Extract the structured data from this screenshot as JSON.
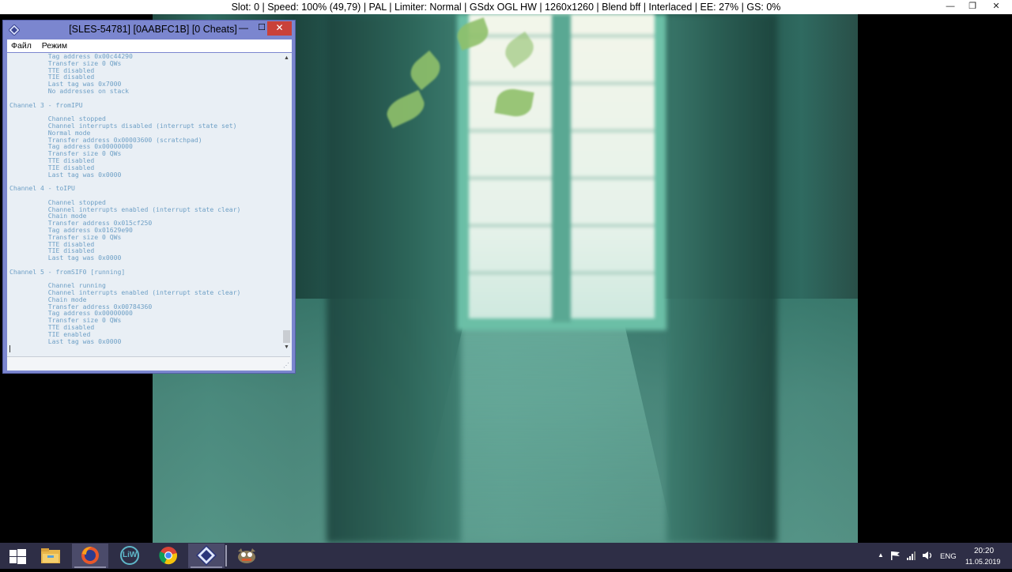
{
  "emulator": {
    "title": "Slot: 0 | Speed: 100% (49,79) | PAL | Limiter: Normal | GSdx OGL HW | 1260x1260 | Blend bff | Interlaced | EE: 27% | GS:  0%",
    "min_glyph": "—",
    "max_glyph": "❐",
    "close_glyph": "✕"
  },
  "console": {
    "title": "[SLES-54781] [0AABFC1B] [0 Cheats]",
    "menu": [
      "Файл",
      "Режим"
    ],
    "min_glyph": "—",
    "max_glyph": "☐",
    "close_glyph": "✕",
    "lines": [
      "          Tag address 0x00c44290",
      "          Transfer size 0 QWs",
      "          TTE disabled",
      "          TIE disabled",
      "          Last tag was 0x7000",
      "          No addresses on stack",
      "",
      "Channel 3 - fromIPU",
      "",
      "          Channel stopped",
      "          Channel interrupts disabled (interrupt state set)",
      "          Normal mode",
      "          Transfer address 0x00003600 (scratchpad)",
      "          Tag address 0x00000000",
      "          Transfer size 0 QWs",
      "          TTE disabled",
      "          TIE disabled",
      "          Last tag was 0x0000",
      "",
      "Channel 4 - toIPU",
      "",
      "          Channel stopped",
      "          Channel interrupts enabled (interrupt state clear)",
      "          Chain mode",
      "          Transfer address 0x015cf250",
      "          Tag address 0x01629e90",
      "          Transfer size 0 QWs",
      "          TTE disabled",
      "          TIE disabled",
      "          Last tag was 0x0000",
      "",
      "Channel 5 - fromSIF0 [running]",
      "",
      "          Channel running",
      "          Channel interrupts enabled (interrupt state clear)",
      "          Chain mode",
      "          Transfer address 0x00784360",
      "          Tag address 0x00000000",
      "          Transfer size 0 QWs",
      "          TTE disabled",
      "          TIE enabled",
      "          Last tag was 0x0000"
    ]
  },
  "taskbar": {
    "apps": [
      {
        "name": "start-button",
        "icon": "windows-logo-icon"
      },
      {
        "name": "file-explorer",
        "icon": "folder-icon"
      },
      {
        "name": "firefox",
        "icon": "firefox-icon"
      },
      {
        "name": "liw",
        "icon": "liw-icon",
        "label": "LiW"
      },
      {
        "name": "chrome",
        "icon": "chrome-icon"
      },
      {
        "name": "pcsx2",
        "icon": "pcsx2-icon"
      },
      {
        "name": "gimp",
        "icon": "gimp-icon"
      }
    ],
    "tray": {
      "language": "ENG",
      "time": "20:20",
      "date": "11.05.2019"
    },
    "colors": {
      "taskbar": "#2e2e46",
      "active": "#4b4b6a"
    }
  }
}
